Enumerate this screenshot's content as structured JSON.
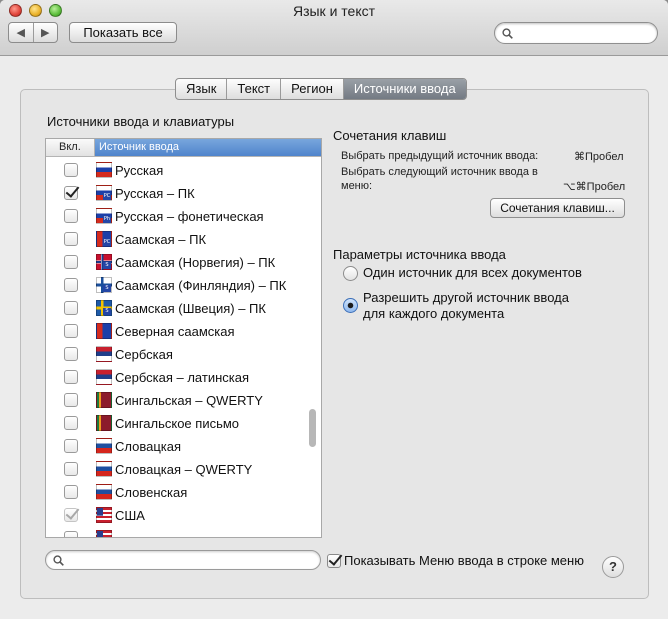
{
  "window": {
    "title": "Язык и текст"
  },
  "toolbar": {
    "back_glyph": "◀",
    "forward_glyph": "▶",
    "show_all_label": "Показать все",
    "search_value": ""
  },
  "tabs": [
    {
      "label": "Язык",
      "active": false
    },
    {
      "label": "Текст",
      "active": false
    },
    {
      "label": "Регион",
      "active": false
    },
    {
      "label": "Источники ввода",
      "active": true
    }
  ],
  "list": {
    "title": "Источники ввода и клавиатуры",
    "col_on": "Вкл.",
    "col_source": "Источник ввода",
    "items": [
      {
        "label": "Русская",
        "checked": false,
        "flag": "ru",
        "badge": ""
      },
      {
        "label": "Русская – ПК",
        "checked": true,
        "flag": "ru",
        "badge": "PC"
      },
      {
        "label": "Русская – фонетическая",
        "checked": false,
        "flag": "ru",
        "badge": "Ph"
      },
      {
        "label": "Саамская – ПК",
        "checked": false,
        "flag": "sami",
        "badge": "PC"
      },
      {
        "label": "Саамская (Норвегия) – ПК",
        "checked": false,
        "flag": "no",
        "badge": "S"
      },
      {
        "label": "Саамская (Финляндия) – ПК",
        "checked": false,
        "flag": "fi",
        "badge": "S"
      },
      {
        "label": "Саамская (Швеция) – ПК",
        "checked": false,
        "flag": "se",
        "badge": "S"
      },
      {
        "label": "Северная саамская",
        "checked": false,
        "flag": "sami",
        "badge": ""
      },
      {
        "label": "Сербская",
        "checked": false,
        "flag": "rs",
        "badge": ""
      },
      {
        "label": "Сербская – латинская",
        "checked": false,
        "flag": "rs",
        "badge": ""
      },
      {
        "label": "Сингальская – QWERTY",
        "checked": false,
        "flag": "lk",
        "badge": ""
      },
      {
        "label": "Сингальское письмо",
        "checked": false,
        "flag": "lk",
        "badge": ""
      },
      {
        "label": "Словацкая",
        "checked": false,
        "flag": "sk",
        "badge": ""
      },
      {
        "label": "Словацкая – QWERTY",
        "checked": false,
        "flag": "sk",
        "badge": ""
      },
      {
        "label": "Словенская",
        "checked": false,
        "flag": "si",
        "badge": ""
      },
      {
        "label": "США",
        "checked": true,
        "dim": true,
        "flag": "us",
        "badge": ""
      },
      {
        "label": "",
        "checked": false,
        "flag": "us",
        "badge": ""
      }
    ]
  },
  "shortcuts": {
    "title": "Сочетания клавиш",
    "prev_label": "Выбрать предыдущий источник ввода:",
    "prev_key": "⌘Пробел",
    "next_label_1": "Выбрать следующий источник ввода в",
    "next_label_2": "меню:",
    "next_key": "⌥⌘Пробел",
    "button_label": "Сочетания клавиш..."
  },
  "options": {
    "title": "Параметры источника ввода",
    "radio1": "Один источник для всех документов",
    "radio2_line1": "Разрешить другой источник ввода",
    "radio2_line2": "для каждого документа",
    "selected": 2
  },
  "bottom": {
    "search_value": "",
    "show_menu_label": "Показывать Меню ввода в строке меню",
    "show_menu_checked": true,
    "help_glyph": "?"
  }
}
